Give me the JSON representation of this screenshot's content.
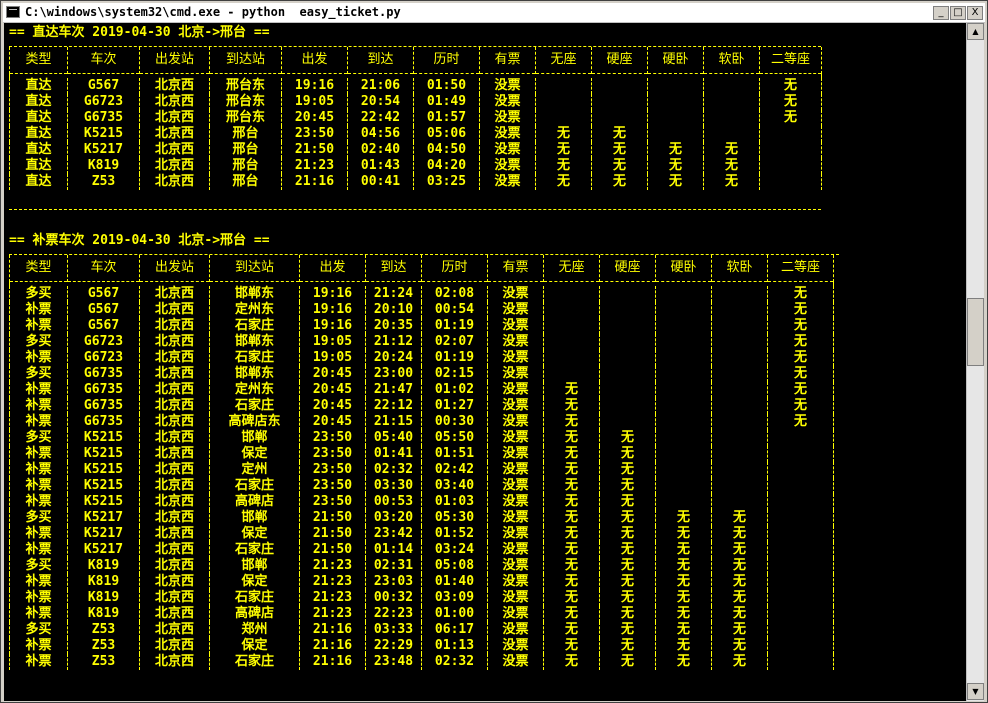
{
  "window": {
    "title": "C:\\windows\\system32\\cmd.exe - python  easy_ticket.py",
    "minimize": "_",
    "maximize": "□",
    "close": "X"
  },
  "section1": {
    "heading": "== 直达车次 2019-04-30 北京->邢台 ==",
    "headers": [
      "类型",
      "车次",
      "出发站",
      "到达站",
      "出发",
      "到达",
      "历时",
      "有票",
      "无座",
      "硬座",
      "硬卧",
      "软卧",
      "二等座"
    ],
    "rows": [
      [
        "直达",
        "G567",
        "北京西",
        "邢台东",
        "19:16",
        "21:06",
        "01:50",
        "没票",
        "",
        "",
        "",
        "",
        "无"
      ],
      [
        "直达",
        "G6723",
        "北京西",
        "邢台东",
        "19:05",
        "20:54",
        "01:49",
        "没票",
        "",
        "",
        "",
        "",
        "无"
      ],
      [
        "直达",
        "G6735",
        "北京西",
        "邢台东",
        "20:45",
        "22:42",
        "01:57",
        "没票",
        "",
        "",
        "",
        "",
        "无"
      ],
      [
        "直达",
        "K5215",
        "北京西",
        "邢台",
        "23:50",
        "04:56",
        "05:06",
        "没票",
        "无",
        "无",
        "",
        "",
        ""
      ],
      [
        "直达",
        "K5217",
        "北京西",
        "邢台",
        "21:50",
        "02:40",
        "04:50",
        "没票",
        "无",
        "无",
        "无",
        "无",
        ""
      ],
      [
        "直达",
        "K819",
        "北京西",
        "邢台",
        "21:23",
        "01:43",
        "04:20",
        "没票",
        "无",
        "无",
        "无",
        "无",
        ""
      ],
      [
        "直达",
        "Z53",
        "北京西",
        "邢台",
        "21:16",
        "00:41",
        "03:25",
        "没票",
        "无",
        "无",
        "无",
        "无",
        ""
      ]
    ]
  },
  "section2": {
    "heading": "== 补票车次 2019-04-30 北京->邢台 ==",
    "headers": [
      "类型",
      "车次",
      "出发站",
      "到达站",
      "出发",
      "到达",
      "历时",
      "有票",
      "无座",
      "硬座",
      "硬卧",
      "软卧",
      "二等座"
    ],
    "rows": [
      [
        "多买",
        "G567",
        "北京西",
        "邯郸东",
        "19:16",
        "21:24",
        "02:08",
        "没票",
        "",
        "",
        "",
        "",
        "无"
      ],
      [
        "补票",
        "G567",
        "北京西",
        "定州东",
        "19:16",
        "20:10",
        "00:54",
        "没票",
        "",
        "",
        "",
        "",
        "无"
      ],
      [
        "补票",
        "G567",
        "北京西",
        "石家庄",
        "19:16",
        "20:35",
        "01:19",
        "没票",
        "",
        "",
        "",
        "",
        "无"
      ],
      [
        "多买",
        "G6723",
        "北京西",
        "邯郸东",
        "19:05",
        "21:12",
        "02:07",
        "没票",
        "",
        "",
        "",
        "",
        "无"
      ],
      [
        "补票",
        "G6723",
        "北京西",
        "石家庄",
        "19:05",
        "20:24",
        "01:19",
        "没票",
        "",
        "",
        "",
        "",
        "无"
      ],
      [
        "多买",
        "G6735",
        "北京西",
        "邯郸东",
        "20:45",
        "23:00",
        "02:15",
        "没票",
        "",
        "",
        "",
        "",
        "无"
      ],
      [
        "补票",
        "G6735",
        "北京西",
        "定州东",
        "20:45",
        "21:47",
        "01:02",
        "没票",
        "无",
        "",
        "",
        "",
        "无"
      ],
      [
        "补票",
        "G6735",
        "北京西",
        "石家庄",
        "20:45",
        "22:12",
        "01:27",
        "没票",
        "无",
        "",
        "",
        "",
        "无"
      ],
      [
        "补票",
        "G6735",
        "北京西",
        "高碑店东",
        "20:45",
        "21:15",
        "00:30",
        "没票",
        "无",
        "",
        "",
        "",
        "无"
      ],
      [
        "多买",
        "K5215",
        "北京西",
        "邯郸",
        "23:50",
        "05:40",
        "05:50",
        "没票",
        "无",
        "无",
        "",
        "",
        ""
      ],
      [
        "补票",
        "K5215",
        "北京西",
        "保定",
        "23:50",
        "01:41",
        "01:51",
        "没票",
        "无",
        "无",
        "",
        "",
        ""
      ],
      [
        "补票",
        "K5215",
        "北京西",
        "定州",
        "23:50",
        "02:32",
        "02:42",
        "没票",
        "无",
        "无",
        "",
        "",
        ""
      ],
      [
        "补票",
        "K5215",
        "北京西",
        "石家庄",
        "23:50",
        "03:30",
        "03:40",
        "没票",
        "无",
        "无",
        "",
        "",
        ""
      ],
      [
        "补票",
        "K5215",
        "北京西",
        "高碑店",
        "23:50",
        "00:53",
        "01:03",
        "没票",
        "无",
        "无",
        "",
        "",
        ""
      ],
      [
        "多买",
        "K5217",
        "北京西",
        "邯郸",
        "21:50",
        "03:20",
        "05:30",
        "没票",
        "无",
        "无",
        "无",
        "无",
        ""
      ],
      [
        "补票",
        "K5217",
        "北京西",
        "保定",
        "21:50",
        "23:42",
        "01:52",
        "没票",
        "无",
        "无",
        "无",
        "无",
        ""
      ],
      [
        "补票",
        "K5217",
        "北京西",
        "石家庄",
        "21:50",
        "01:14",
        "03:24",
        "没票",
        "无",
        "无",
        "无",
        "无",
        ""
      ],
      [
        "多买",
        "K819",
        "北京西",
        "邯郸",
        "21:23",
        "02:31",
        "05:08",
        "没票",
        "无",
        "无",
        "无",
        "无",
        ""
      ],
      [
        "补票",
        "K819",
        "北京西",
        "保定",
        "21:23",
        "23:03",
        "01:40",
        "没票",
        "无",
        "无",
        "无",
        "无",
        ""
      ],
      [
        "补票",
        "K819",
        "北京西",
        "石家庄",
        "21:23",
        "00:32",
        "03:09",
        "没票",
        "无",
        "无",
        "无",
        "无",
        ""
      ],
      [
        "补票",
        "K819",
        "北京西",
        "高碑店",
        "21:23",
        "22:23",
        "01:00",
        "没票",
        "无",
        "无",
        "无",
        "无",
        ""
      ],
      [
        "多买",
        "Z53",
        "北京西",
        "郑州",
        "21:16",
        "03:33",
        "06:17",
        "没票",
        "无",
        "无",
        "无",
        "无",
        ""
      ],
      [
        "补票",
        "Z53",
        "北京西",
        "保定",
        "21:16",
        "22:29",
        "01:13",
        "没票",
        "无",
        "无",
        "无",
        "无",
        ""
      ],
      [
        "补票",
        "Z53",
        "北京西",
        "石家庄",
        "21:16",
        "23:48",
        "02:32",
        "没票",
        "无",
        "无",
        "无",
        "无",
        ""
      ]
    ]
  },
  "scrollbar": {
    "up": "▲",
    "down": "▼"
  }
}
